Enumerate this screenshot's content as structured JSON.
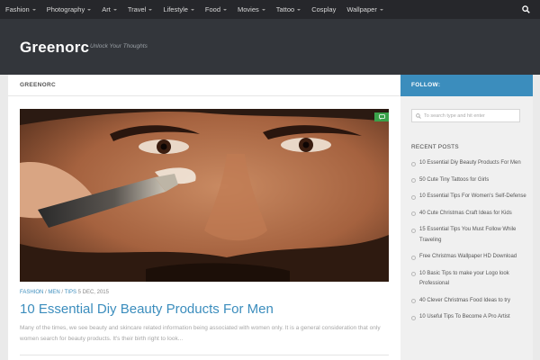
{
  "nav": {
    "items": [
      {
        "label": "Fashion",
        "caret": true
      },
      {
        "label": "Photography",
        "caret": true
      },
      {
        "label": "Art",
        "caret": true
      },
      {
        "label": "Travel",
        "caret": true
      },
      {
        "label": "Lifestyle",
        "caret": true
      },
      {
        "label": "Food",
        "caret": true
      },
      {
        "label": "Movies",
        "caret": true
      },
      {
        "label": "Tattoo",
        "caret": true
      },
      {
        "label": "Cosplay",
        "caret": false
      },
      {
        "label": "Wallpaper",
        "caret": true
      }
    ],
    "search_icon": "search-icon"
  },
  "header": {
    "site_title": "Greenorc",
    "tagline": "Unlock Your Thoughts"
  },
  "main": {
    "breadcrumb": "GREENORC",
    "post": {
      "categories": [
        "FASHION",
        "MEN",
        "TIPS"
      ],
      "date": "5 DEC, 2015",
      "title": "10 Essential Diy Beauty Products For Men",
      "excerpt": "Many of the times, we see beauty and skincare related information being associated with women only. It is a general consideration that only women search for beauty products. It's their birth right to look...",
      "comment_icon": "comment-icon"
    }
  },
  "sidebar": {
    "follow_label": "FOLLOW:",
    "search_placeholder": "To search type and hit enter",
    "recent_title": "RECENT POSTS",
    "recent_posts": [
      "10 Essential Diy Beauty Products For Men",
      "50 Cute Tiny Tattoos for Girls",
      "10 Essential Tips For Women's Self-Defense",
      "40 Cute Christmas Craft Ideas for Kids",
      "15 Essential Tips You Must Follow While Traveling",
      "Free Christmas Wallpaper HD Download",
      "10 Basic Tips to make your Logo look Professional",
      "40 Clever Christmas Food Ideas to try",
      "10 Useful Tips To Become A Pro Artist"
    ]
  },
  "colors": {
    "accent": "#3b8dbd",
    "nav_bg": "#26272b",
    "header_bg": "#33363b",
    "badge": "#3aa14a"
  }
}
